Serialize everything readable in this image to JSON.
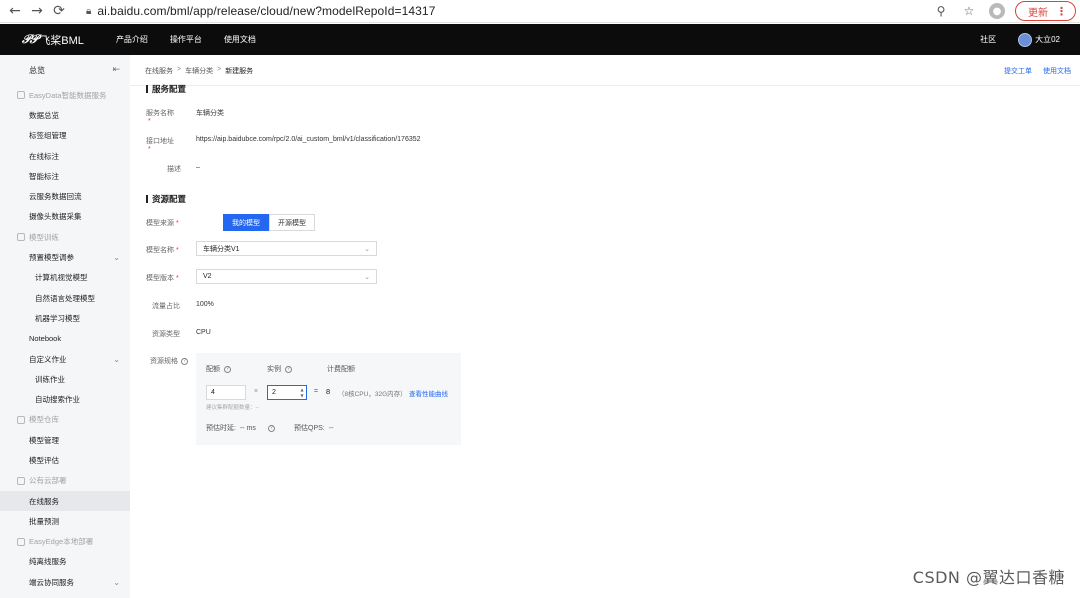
{
  "browser": {
    "url": "ai.baidu.com/bml/app/release/cloud/new?modelRepoId=14317",
    "update_label": "更新"
  },
  "header": {
    "logo_text": "飞桨BML",
    "nav": [
      "产品介绍",
      "操作平台",
      "使用文档"
    ],
    "community": "社区",
    "user": "大立02"
  },
  "sidebar": {
    "top": "总览",
    "items": [
      {
        "label": "EasyData智能数据服务",
        "kind": "group"
      },
      {
        "label": "数据总览",
        "kind": "item"
      },
      {
        "label": "标签组管理",
        "kind": "item"
      },
      {
        "label": "在线标注",
        "kind": "item"
      },
      {
        "label": "智能标注",
        "kind": "item"
      },
      {
        "label": "云服务数据回流",
        "kind": "item"
      },
      {
        "label": "摄像头数据采集",
        "kind": "item"
      },
      {
        "label": "模型训练",
        "kind": "group"
      },
      {
        "label": "预置模型调参",
        "kind": "item",
        "chevron": true
      },
      {
        "label": "计算机视觉模型",
        "kind": "sub"
      },
      {
        "label": "自然语言处理模型",
        "kind": "sub"
      },
      {
        "label": "机器学习模型",
        "kind": "sub"
      },
      {
        "label": "Notebook",
        "kind": "item"
      },
      {
        "label": "自定义作业",
        "kind": "item",
        "chevron": true
      },
      {
        "label": "训练作业",
        "kind": "sub"
      },
      {
        "label": "自动搜索作业",
        "kind": "sub"
      },
      {
        "label": "模型仓库",
        "kind": "group"
      },
      {
        "label": "模型管理",
        "kind": "item"
      },
      {
        "label": "模型评估",
        "kind": "item"
      },
      {
        "label": "公有云部署",
        "kind": "group"
      },
      {
        "label": "在线服务",
        "kind": "item",
        "active": true
      },
      {
        "label": "批量预测",
        "kind": "item"
      },
      {
        "label": "EasyEdge本地部署",
        "kind": "group"
      },
      {
        "label": "纯离线服务",
        "kind": "item"
      },
      {
        "label": "端云协同服务",
        "kind": "item",
        "chevron": true
      }
    ]
  },
  "breadcrumb": {
    "items": [
      "在线服务",
      "车辆分类",
      "新建服务"
    ]
  },
  "top_links": {
    "ticket": "提交工单",
    "docs": "使用文档"
  },
  "service_config": {
    "title": "服务配置",
    "name_label": "服务名称",
    "name_value": "车辆分类",
    "api_label": "接口地址",
    "api_value": "https://aip.baidubce.com/rpc/2.0/ai_custom_bml/v1/classification/176352",
    "desc_label": "描述",
    "desc_value": "–"
  },
  "resource_config": {
    "title": "资源配置",
    "source_label": "模型来源",
    "source_options": [
      "我的模型",
      "开源模型"
    ],
    "model_name_label": "模型名称",
    "model_name_value": "车辆分类V1",
    "model_version_label": "模型版本",
    "model_version_value": "V2",
    "traffic_label": "流量占比",
    "traffic_value": "100%",
    "resource_type_label": "资源类型",
    "resource_type_value": "CPU",
    "spec_label": "资源规格"
  },
  "spec": {
    "quota_label": "配额",
    "instance_label": "实例",
    "billing_label": "计费配额",
    "quota_value": "4",
    "instance_value": "2",
    "times": "×",
    "equals": "=",
    "billing_value": "8",
    "billing_desc": "（8核CPU，32G内存）",
    "perf_link": "查看性能曲线",
    "hint": "建议集群配额数量：--",
    "latency_label": "预估时延:",
    "latency_value": "-- ms",
    "qps_label": "预估QPS:",
    "qps_value": "--"
  },
  "watermark": "CSDN @翼达口香糖"
}
